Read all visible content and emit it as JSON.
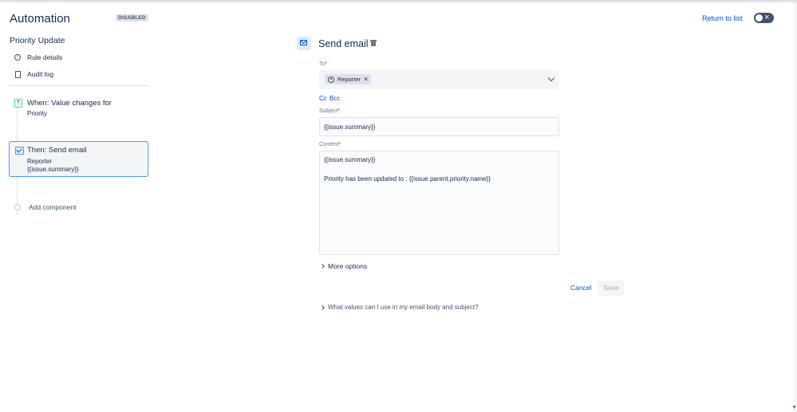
{
  "header": {
    "title": "Automation",
    "status_badge": "DISABLED",
    "return_link": "Return to list"
  },
  "sidebar": {
    "rule_name": "Priority Update",
    "items": [
      {
        "label": "Rule details",
        "icon": "info-icon"
      },
      {
        "label": "Audit log",
        "icon": "document-icon"
      }
    ],
    "trigger": {
      "title": "When: Value changes for",
      "detail": "Priority",
      "icon": "trigger-icon"
    },
    "action": {
      "title": "Then: Send email",
      "detail_1": "Reporter",
      "detail_2": "{{issue.summary}}",
      "icon": "email-icon"
    },
    "add_component": "Add component"
  },
  "panel": {
    "title": "Send email",
    "to": {
      "label": "To",
      "required": "*",
      "chip": "Reporter"
    },
    "cc_label": "Cc",
    "bcc_label": "Bcc",
    "subject": {
      "label": "Subject",
      "required": "*",
      "value": "{{issue.summary}}"
    },
    "content": {
      "label": "Content",
      "required": "*",
      "line_1": "{{issue.summary}}",
      "line_2": "Priority has been updated to : {{issue.parent.priority.name}}"
    },
    "more_options": "More options",
    "cancel": "Cancel",
    "save": "Save",
    "help": "What values can I use in my email body and subject?"
  },
  "colors": {
    "accent": "#0052cc",
    "selected_border": "#4c9aff",
    "toggle_off": "#42526e"
  }
}
